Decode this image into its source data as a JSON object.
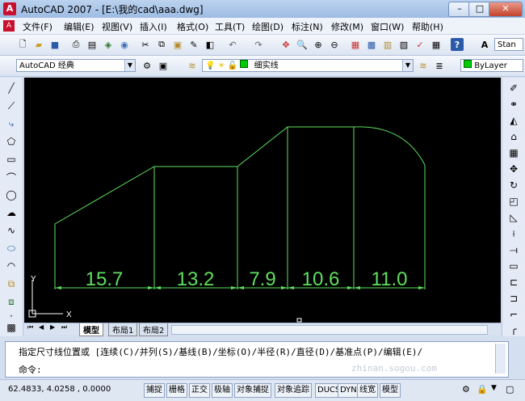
{
  "window": {
    "title": "AutoCAD 2007 - [E:\\我的cad\\aaa.dwg]",
    "minimize": "–",
    "restore": "□",
    "close": "✕"
  },
  "menubar": {
    "items": [
      "文件(F)",
      "编辑(E)",
      "视图(V)",
      "插入(I)",
      "格式(O)",
      "工具(T)",
      "绘图(D)",
      "标注(N)",
      "修改(M)",
      "窗口(W)",
      "帮助(H)"
    ]
  },
  "toolbar2": {
    "workspace": "AutoCAD 经典",
    "layer": "细实线",
    "bylayer": "ByLayer",
    "textstyle": "Stan"
  },
  "drawing": {
    "ucs_y": "Y",
    "ucs_x": "X",
    "dimensions": [
      "15.7",
      "13.2",
      "7.9",
      "10.6",
      "11.0"
    ]
  },
  "tabs": {
    "nav": [
      "⏮",
      "◀",
      "▶",
      "⏭"
    ],
    "items": [
      "模型",
      "布局1",
      "布局2"
    ]
  },
  "command": {
    "history": "指定尺寸线位置或 [连续(C)/并列(S)/基线(B)/坐标(O)/半径(R)/直径(D)/基准点(P)/编辑(E)/",
    "prompt": "命令:",
    "watermark": "zhinan.sogou.com"
  },
  "statusbar": {
    "coords": "62.4833, 4.0258 , 0.0000",
    "toggles": [
      "捕捉",
      "栅格",
      "正交",
      "极轴",
      "对象捕捉",
      "对象追踪",
      "DUCS",
      "DYN",
      "线宽",
      "模型"
    ]
  }
}
